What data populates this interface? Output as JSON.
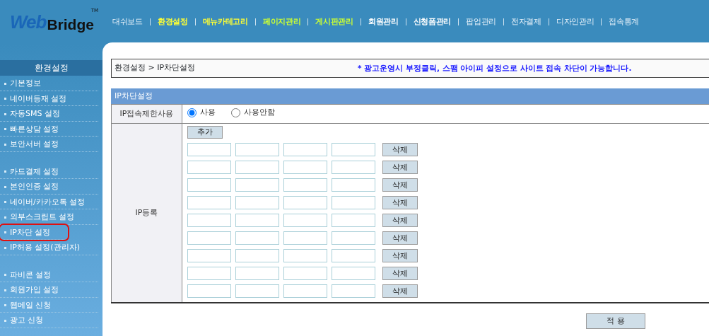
{
  "logo": {
    "word_a": "Web",
    "word_b": "Bridge",
    "mark": "TM"
  },
  "top_menu": [
    {
      "label": "대쉬보드",
      "kind": "plain"
    },
    {
      "label": "환경설정",
      "kind": "yellow"
    },
    {
      "label": "메뉴카테고리",
      "kind": "yellow"
    },
    {
      "label": "페이지관리",
      "kind": "lime"
    },
    {
      "label": "게시판관리",
      "kind": "lime"
    },
    {
      "label": "회원관리",
      "kind": "bold"
    },
    {
      "label": "신청폼관리",
      "kind": "bold"
    },
    {
      "label": "팝업관리",
      "kind": "plain"
    },
    {
      "label": "전자결제",
      "kind": "plain"
    },
    {
      "label": "디자인관리",
      "kind": "plain"
    },
    {
      "label": "접속통계",
      "kind": "plain"
    }
  ],
  "sidebar": {
    "title": "환경설정",
    "groups": [
      {
        "items": [
          {
            "label": "기본정보",
            "selected": false
          },
          {
            "label": "네이버등재 설정",
            "selected": false
          },
          {
            "label": "자동SMS 설정",
            "selected": false
          },
          {
            "label": "빠른상담 설정",
            "selected": false
          },
          {
            "label": "보안서버 설정",
            "selected": false
          }
        ]
      },
      {
        "items": [
          {
            "label": "카드결제 설정",
            "selected": false
          },
          {
            "label": "본인인증 설정",
            "selected": false
          },
          {
            "label": "네이버/카카오톡 설정",
            "selected": false
          },
          {
            "label": "외부스크립트 설정",
            "selected": false
          },
          {
            "label": "IP차단 설정",
            "selected": true
          },
          {
            "label": "IP허용 설정(관리자)",
            "selected": false
          }
        ]
      },
      {
        "items": [
          {
            "label": "파비콘 설정",
            "selected": false
          },
          {
            "label": "회원가입 설정",
            "selected": false
          },
          {
            "label": "웹메일 신청",
            "selected": false
          },
          {
            "label": "광고 신청",
            "selected": false
          }
        ]
      }
    ]
  },
  "breadcrumb": "환경설정 > IP차단설정",
  "notice": "* 광고운영시 부정클릭, 스팸 아이피 설정으로 사이트 접속 차단이 가능합니다.",
  "section_title": "IP차단설정",
  "restrict": {
    "label": "IP접속제한사용",
    "options": [
      {
        "label": "사용",
        "selected": true
      },
      {
        "label": "사용안함",
        "selected": false
      }
    ]
  },
  "ip_register": {
    "label": "IP등록",
    "add_button": "추가",
    "rows": [
      {
        "delete_button": "삭제"
      },
      {
        "delete_button": "삭제"
      },
      {
        "delete_button": "삭제"
      },
      {
        "delete_button": "삭제"
      },
      {
        "delete_button": "삭제"
      },
      {
        "delete_button": "삭제"
      },
      {
        "delete_button": "삭제"
      },
      {
        "delete_button": "삭제"
      },
      {
        "delete_button": "삭제"
      }
    ]
  },
  "apply_button": "적 용"
}
